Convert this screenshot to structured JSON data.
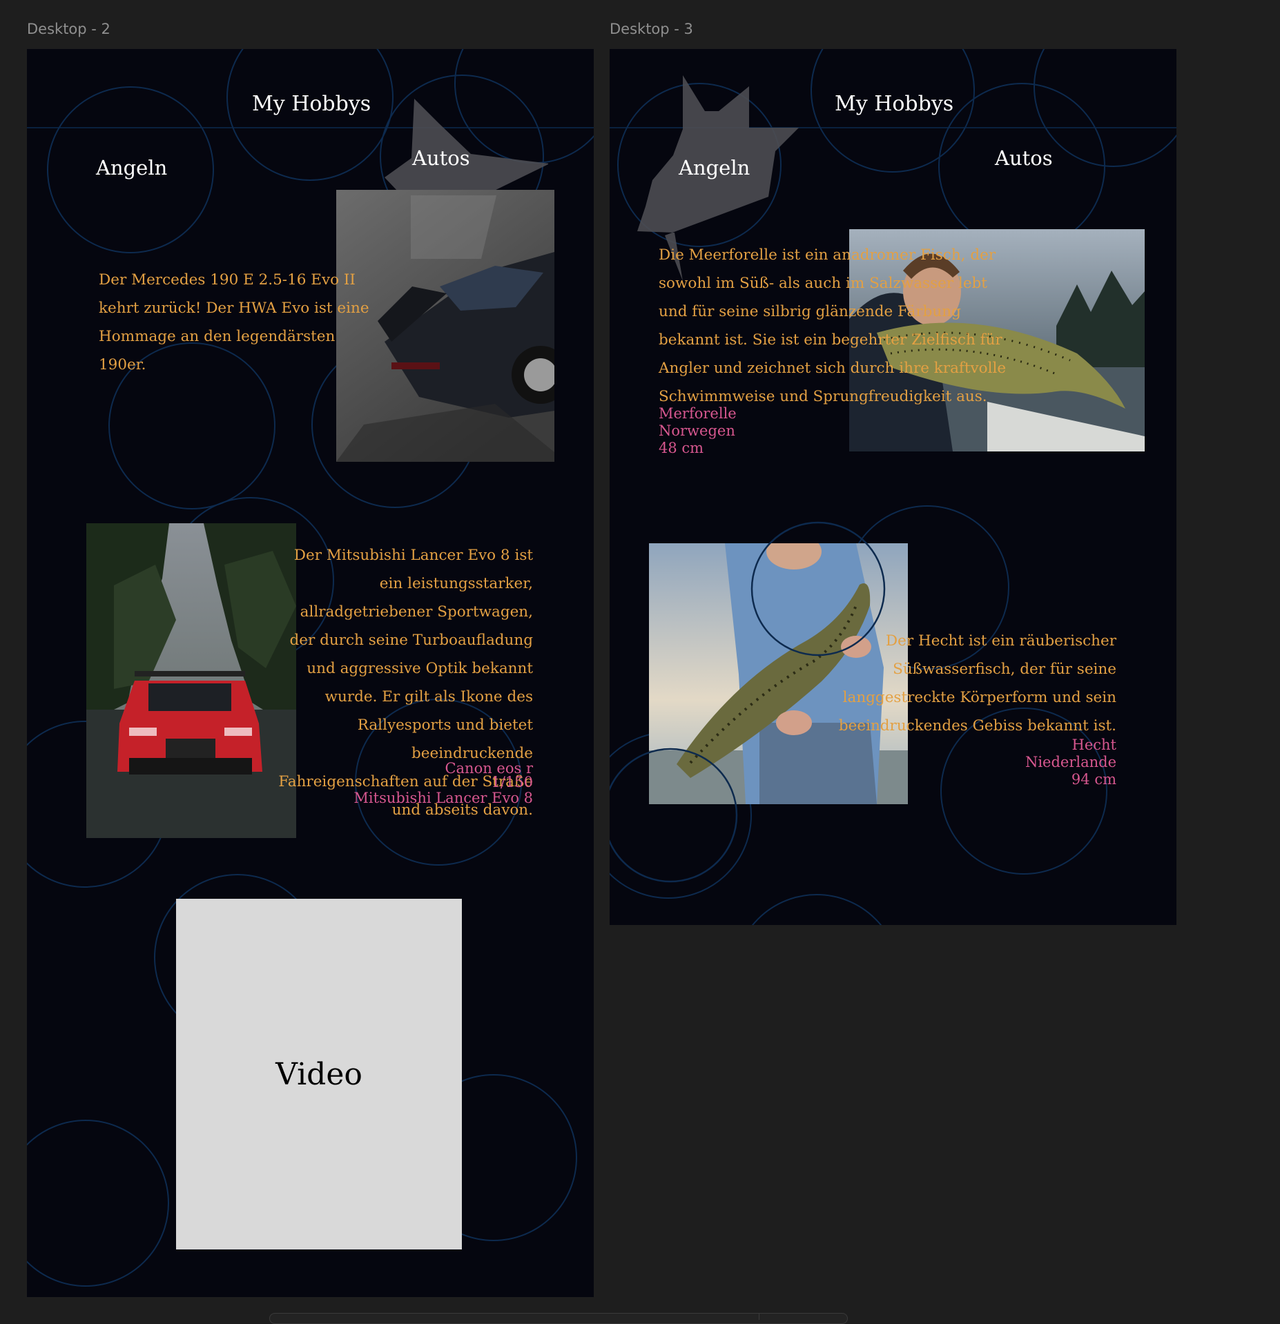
{
  "frames": [
    {
      "label": "Desktop - 2",
      "title": "My Hobbys",
      "nav": {
        "left": "Angeln",
        "right": "Autos"
      },
      "car1": {
        "text": "Der Mercedes 190 E 2.5-16 Evo II kehrt zurück! Der HWA Evo ist eine Hommage an den legendärsten 190er.",
        "image_name": "mercedes-190e-photo"
      },
      "car2": {
        "text": "Der Mitsubishi Lancer Evo 8 ist ein leistungsstarker, allradgetriebener Sportwagen, der durch seine Turboaufladung und aggressive Optik bekannt wurde. Er gilt als Ikone des Rallyesports und bietet beeindruckende Fahreigenschaften auf der Straße und abseits davon.",
        "camera": "Canon eos r",
        "shutter": "1/150",
        "model": "Mitsubishi Lancer Evo 8",
        "image_name": "mitsubishi-lancer-photo"
      },
      "video_label": "Video"
    },
    {
      "label": "Desktop - 3",
      "title": "My Hobbys",
      "nav": {
        "left": "Angeln",
        "right": "Autos"
      },
      "fish1": {
        "text": "Die Meerforelle ist ein anadromer Fisch, der sowohl im Süß- als auch im Salzwasser lebt und für seine silbrig glänzende Färbung bekannt ist. Sie ist ein begehrter Zielfisch für Angler und zeichnet sich durch ihre kraftvolle Schwimmweise und Sprungfreudigkeit aus.",
        "species": "Merforelle",
        "place": "Norwegen",
        "size": "48 cm",
        "image_name": "trout-photo"
      },
      "fish2": {
        "text": "Der Hecht ist ein räuberischer Süßwasserfisch, der für seine langgestreckte Körperform und sein beeindruckendes Gebiss bekannt ist.",
        "species": "Hecht",
        "place": "Niederlande",
        "size": "94 cm",
        "image_name": "pike-photo"
      }
    }
  ],
  "colors": {
    "canvas": "#1e1e1e",
    "frame_bg": "#05060f",
    "circle_stroke": "#0d2a4e",
    "body_text": "#e3a043",
    "meta_text": "#d7578f",
    "star_shape": "#4c4c52",
    "video_placeholder": "#d9d9d9"
  }
}
